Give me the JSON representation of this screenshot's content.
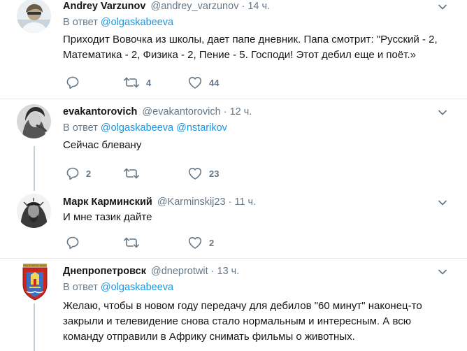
{
  "tweets": [
    {
      "name": "Andrey Varzunov",
      "handle": "@andrey_varzunov",
      "time": "14 ч.",
      "reply_prefix": "В ответ",
      "reply_to": [
        "@olgaskabeeva"
      ],
      "text": "Приходит Вовочка из школы, дает папе дневник. Папа смотрит: \"Русский - 2, Математика - 2, Физика - 2, Пение - 5. Господи! Этот дебил еще и поёт.»",
      "replies": "",
      "retweets": "4",
      "likes": "44"
    },
    {
      "name": "evakantorovich",
      "handle": "@evakantorovich",
      "time": "12 ч.",
      "reply_prefix": "В ответ",
      "reply_to": [
        "@olgaskabeeva",
        "@nstarikov"
      ],
      "text": "Сейчас блевану",
      "replies": "2",
      "retweets": "",
      "likes": "23"
    },
    {
      "name": "Марк Карминский",
      "handle": "@Karminskij23",
      "time": "11 ч.",
      "text": "И мне тазик дайте",
      "replies": "",
      "retweets": "",
      "likes": "2"
    },
    {
      "name": "Днепропетровск",
      "handle": "@dneprotwit",
      "time": "13 ч.",
      "reply_prefix": "В ответ",
      "reply_to": [
        "@olgaskabeeva"
      ],
      "text": "Желаю, чтобы в новом году передачу для дебилов \"60 минут\" наконец-то закрыли и телевидение снова стало нормальным и интересным. А всю команду отправили в Африку снимать фильмы о животных.",
      "avatar_text": "ЕКАТЕРИНОСЛАВЪ"
    }
  ],
  "dot": "·",
  "colors": {
    "link": "#1b95e0",
    "muted": "#657786",
    "separator": "#e6ecf0",
    "thread_line": "#c4cfd6"
  },
  "icons": [
    "avatar",
    "chevron-down-icon",
    "reply-icon",
    "retweet-icon",
    "like-icon"
  ]
}
